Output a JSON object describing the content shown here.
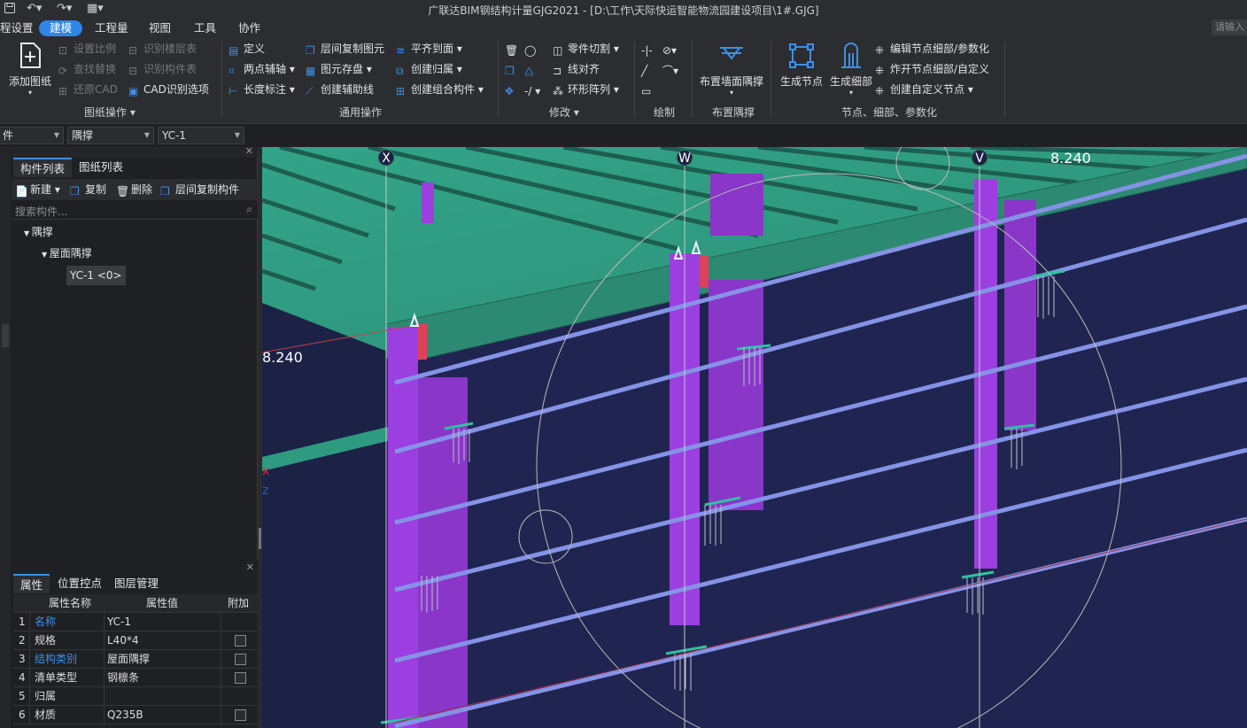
{
  "titlebar": {
    "title": "广联达BIM钢结构计量GJG2021 - [D:\\工作\\天际快运智能物流园建设项目\\1#.GJG]"
  },
  "menubar": {
    "items": [
      "程设置",
      "建模",
      "工程量",
      "视图",
      "工具",
      "协作"
    ],
    "active": "建模",
    "search_placeholder": "请输入"
  },
  "ribbon": {
    "drawing_ops": {
      "add_drawing": "添加图纸",
      "set_scale": "设置比例",
      "find_replace": "查找替换",
      "restore_cad": "还原CAD",
      "identify_floors": "识别楼层表",
      "identify_components": "识别构件表",
      "cad_options": "CAD识别选项",
      "group_label": "图纸操作"
    },
    "common_ops": {
      "define": "定义",
      "two_point_axis": "两点辅轴",
      "length_dim": "长度标注",
      "copy_between_floors": "层间复制图元",
      "save_element": "图元存盘",
      "create_aux_line": "创建辅助线",
      "align_top": "平齐到面",
      "create_group": "创建归属",
      "create_combo": "创建组合构件",
      "group_label": "通用操作"
    },
    "modify": {
      "part_cut": "零件切割",
      "line_align": "线对齐",
      "ring_array": "环形阵列",
      "group_label": "修改"
    },
    "draw": {
      "group_label": "绘制"
    },
    "place_brace": {
      "button": "布置墙面隅撑",
      "group_label": "布置隅撑"
    },
    "nodes": {
      "generate_node": "生成节点",
      "generate_detail": "生成细部",
      "edit_node": "编辑节点细部/参数化",
      "explode_node": "炸开节点细部/自定义",
      "create_custom": "创建自定义节点",
      "group_label": "节点、细部、参数化"
    }
  },
  "combobar": {
    "combo1": "件",
    "combo2": "隅撑",
    "combo3": "YC-1"
  },
  "component_panel": {
    "tabs": [
      "构件列表",
      "图纸列表"
    ],
    "active_tab": "构件列表",
    "toolbar": {
      "new": "新建",
      "copy": "复制",
      "delete": "删除",
      "copy_floor": "层间复制构件"
    },
    "search_placeholder": "搜索构件...",
    "tree": {
      "root": "隅撑",
      "child": "屋面隅撑",
      "leaf": "YC-1 <0>"
    }
  },
  "property_panel": {
    "tabs": [
      "属性",
      "位置控点",
      "图层管理"
    ],
    "active_tab": "属性",
    "headers": {
      "name": "属性名称",
      "value": "属性值",
      "extra": "附加"
    },
    "rows": [
      {
        "idx": "1",
        "name": "名称",
        "value": "YC-1",
        "blue": true,
        "check": false
      },
      {
        "idx": "2",
        "name": "规格",
        "value": "L40*4",
        "blue": false,
        "check": true
      },
      {
        "idx": "3",
        "name": "结构类别",
        "value": "屋面隅撑",
        "blue": true,
        "check": true
      },
      {
        "idx": "4",
        "name": "清单类型",
        "value": "钢檩条",
        "blue": false,
        "check": true
      },
      {
        "idx": "5",
        "name": "归属",
        "value": "",
        "blue": false,
        "check": false
      },
      {
        "idx": "6",
        "name": "材质",
        "value": "Q235B",
        "blue": false,
        "check": true
      }
    ]
  },
  "viewport": {
    "axis_labels": [
      "X",
      "W",
      "V"
    ],
    "elevation_left": "8.240",
    "elevation_right": "8.240",
    "colors": {
      "background": "#1c2246",
      "roof": "#2f9a82",
      "column": "#9b3fe0",
      "purlin": "#7f8ee0"
    }
  }
}
